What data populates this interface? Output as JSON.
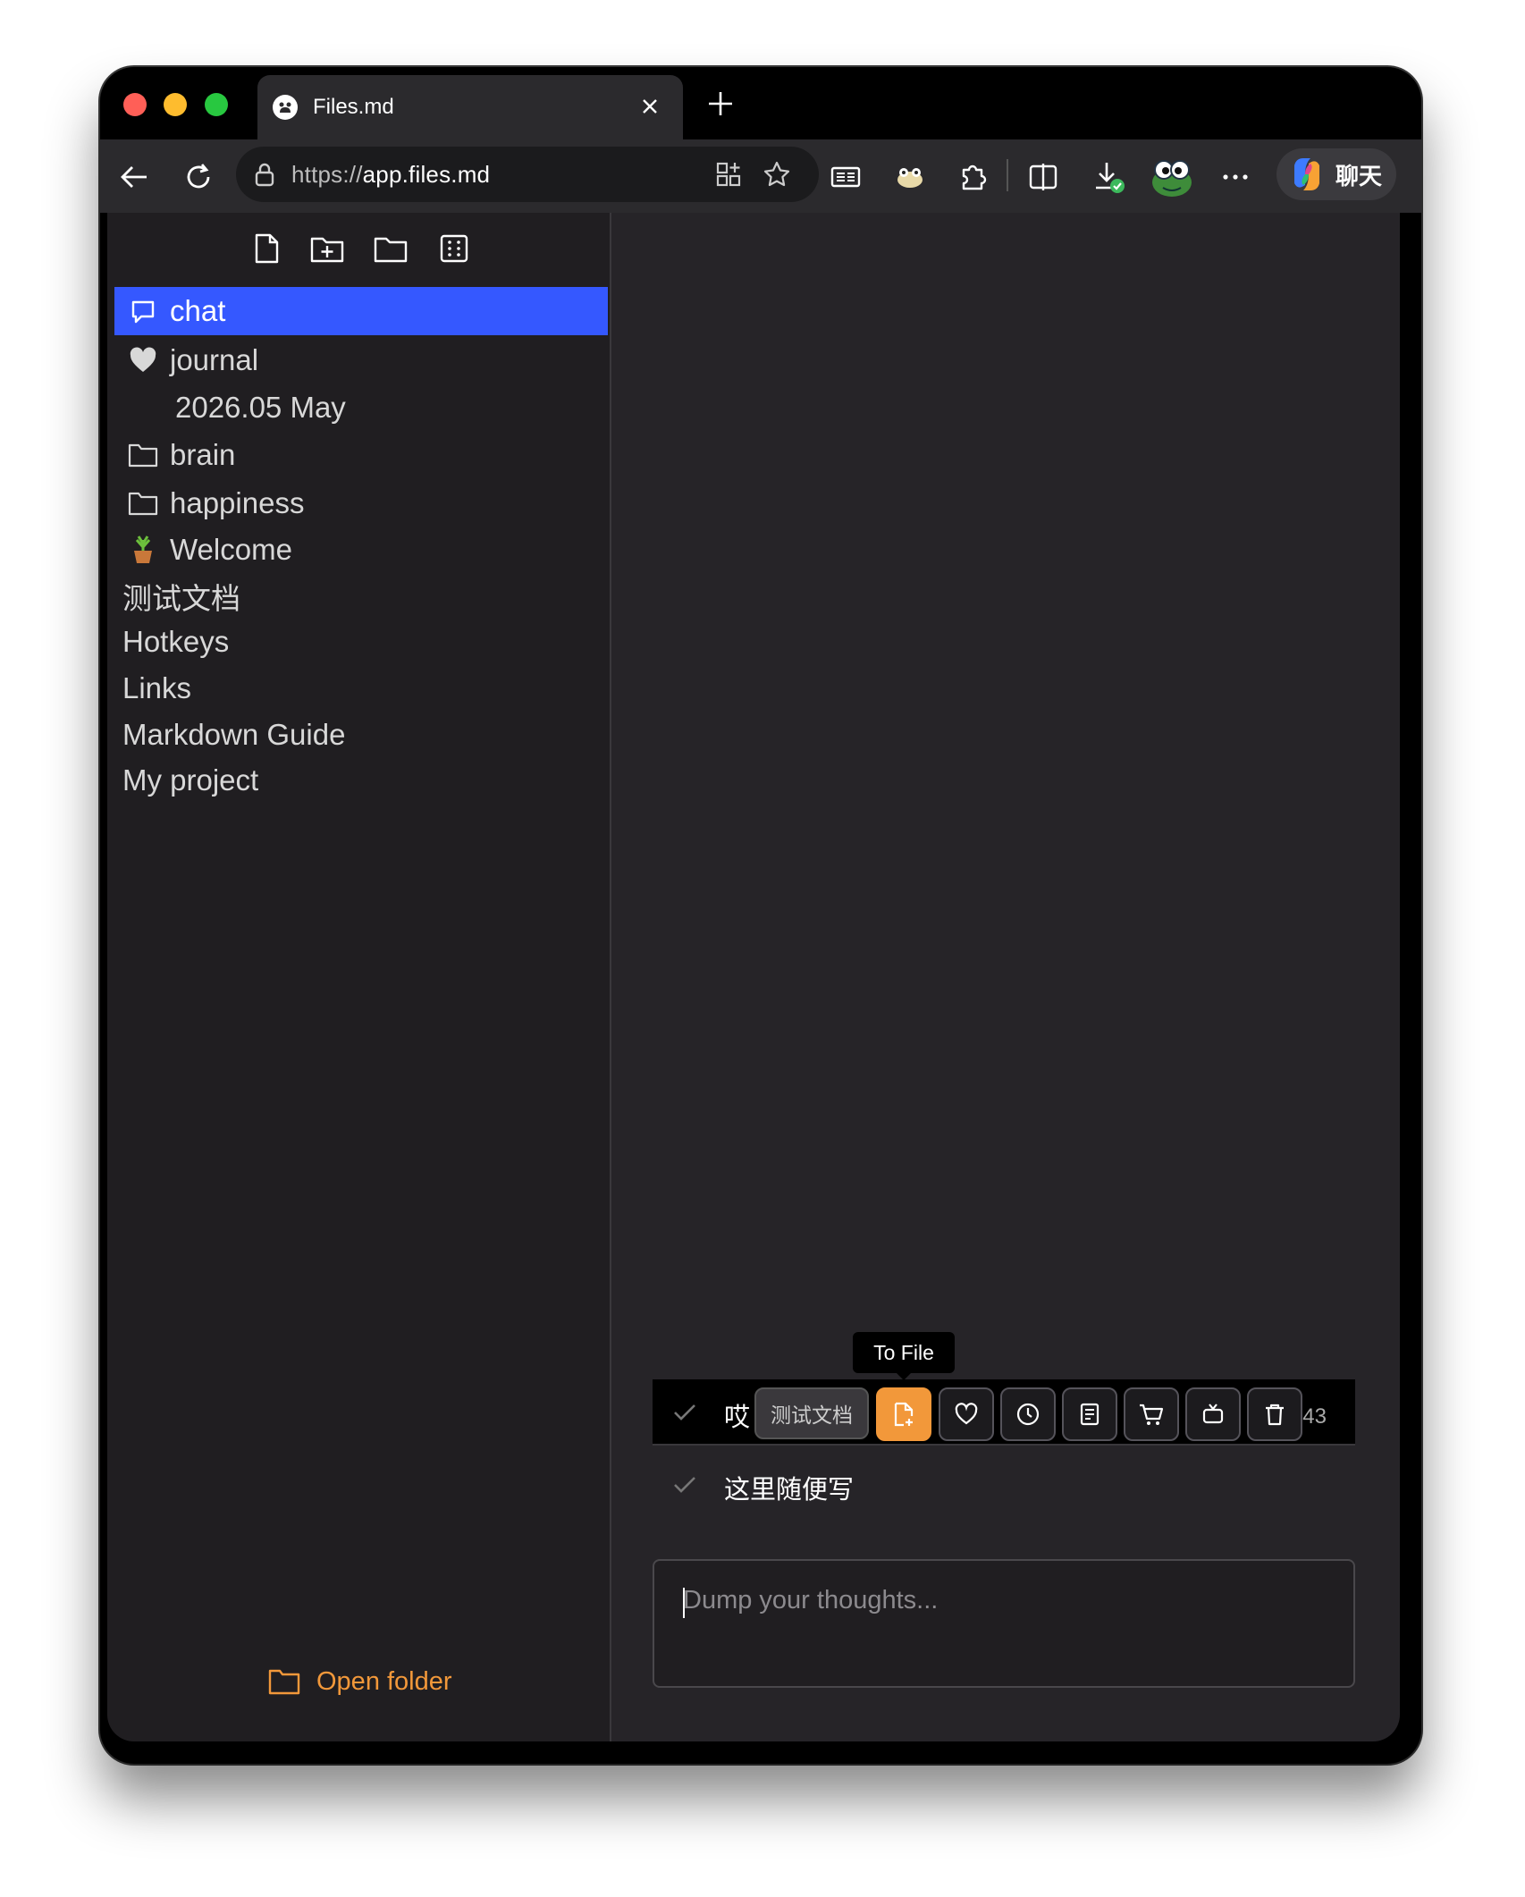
{
  "browser": {
    "tab_title": "Files.md",
    "url_scheme": "https://",
    "url_host": "app.files.md",
    "copilot_label": "聊天"
  },
  "sidebar": {
    "items": [
      {
        "label": "chat",
        "icon": "chat-bubble-icon",
        "active": true
      },
      {
        "label": "journal",
        "icon": "heart-icon"
      },
      {
        "label": "2026.05 May",
        "icon": ""
      },
      {
        "label": "brain",
        "icon": "folder-icon"
      },
      {
        "label": "happiness",
        "icon": "folder-icon"
      },
      {
        "label": "Welcome",
        "icon": "cactus-emoji"
      },
      {
        "label": "测试文档",
        "icon": ""
      },
      {
        "label": "Hotkeys",
        "icon": ""
      },
      {
        "label": "Links",
        "icon": ""
      },
      {
        "label": "Markdown Guide",
        "icon": ""
      },
      {
        "label": "My project",
        "icon": ""
      }
    ],
    "open_folder_label": "Open folder"
  },
  "chat": {
    "messages": [
      {
        "text_visible": "哎",
        "count_visible": "43",
        "checked": true
      },
      {
        "text": "这里随便写",
        "checked": true
      }
    ],
    "action_bar": {
      "tooltip": "To File",
      "target_chip": "测试文档",
      "buttons": [
        "to-file",
        "favorite",
        "reminder",
        "note",
        "shopping",
        "tv",
        "delete"
      ]
    },
    "composer_placeholder": "Dump your thoughts..."
  },
  "colors": {
    "accent_blue": "#3558ff",
    "accent_orange": "#f2983a",
    "sidebar_bg": "#201e21",
    "main_bg": "#262428"
  }
}
